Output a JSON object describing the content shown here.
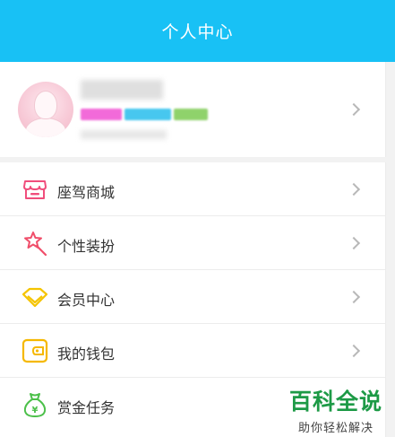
{
  "header": {
    "title": "个人中心"
  },
  "profile": {
    "avatar_icon": "avatar-icon",
    "badge_colors": [
      "#f26ad9",
      "#47c7ef",
      "#8fd26b"
    ]
  },
  "menu": {
    "items": [
      {
        "label": "座驾商城",
        "icon": "store-icon",
        "color": "#f04e7c"
      },
      {
        "label": "个性装扮",
        "icon": "magic-wand-icon",
        "color": "#f04e6a"
      },
      {
        "label": "会员中心",
        "icon": "diamond-icon",
        "color": "#f5c400"
      },
      {
        "label": "我的钱包",
        "icon": "wallet-icon",
        "color": "#f5b800"
      },
      {
        "label": "赏金任务",
        "icon": "money-bag-icon",
        "color": "#4cc04a"
      }
    ]
  },
  "watermark": {
    "main": "百科全说",
    "sub": "助你轻松解决"
  },
  "colors": {
    "accent": "#18c1f5"
  }
}
